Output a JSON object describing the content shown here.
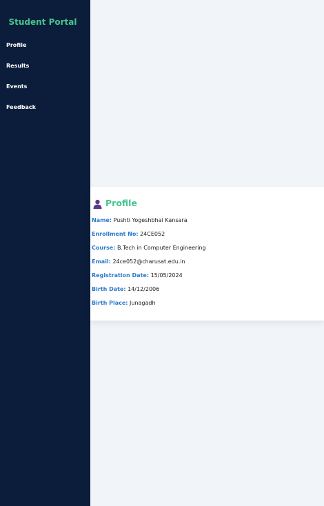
{
  "sidebar": {
    "brand": "Student Portal",
    "items": [
      {
        "label": "Profile"
      },
      {
        "label": "Results"
      },
      {
        "label": "Events"
      },
      {
        "label": "Feedback"
      }
    ]
  },
  "profile": {
    "title": "Profile",
    "icon": "user-icon",
    "fields": [
      {
        "label": "Name:",
        "value": "Pushti Yogeshbhai Kansara"
      },
      {
        "label": "Enrollment No:",
        "value": "24CE052"
      },
      {
        "label": "Course:",
        "value": "B.Tech in Computer Engineering"
      },
      {
        "label": "Email:",
        "value": "24ce052@charusat.edu.in"
      },
      {
        "label": "Registration Date:",
        "value": "15/05/2024"
      },
      {
        "label": "Birth Date:",
        "value": "14/12/2006"
      },
      {
        "label": "Birth Place:",
        "value": "Junagadh"
      }
    ]
  },
  "colors": {
    "sidebar_bg": "#0b1d3a",
    "accent": "#46c58e",
    "label": "#2b7ac9",
    "page_bg": "#f1f4f8",
    "icon": "#5b3a8c"
  }
}
